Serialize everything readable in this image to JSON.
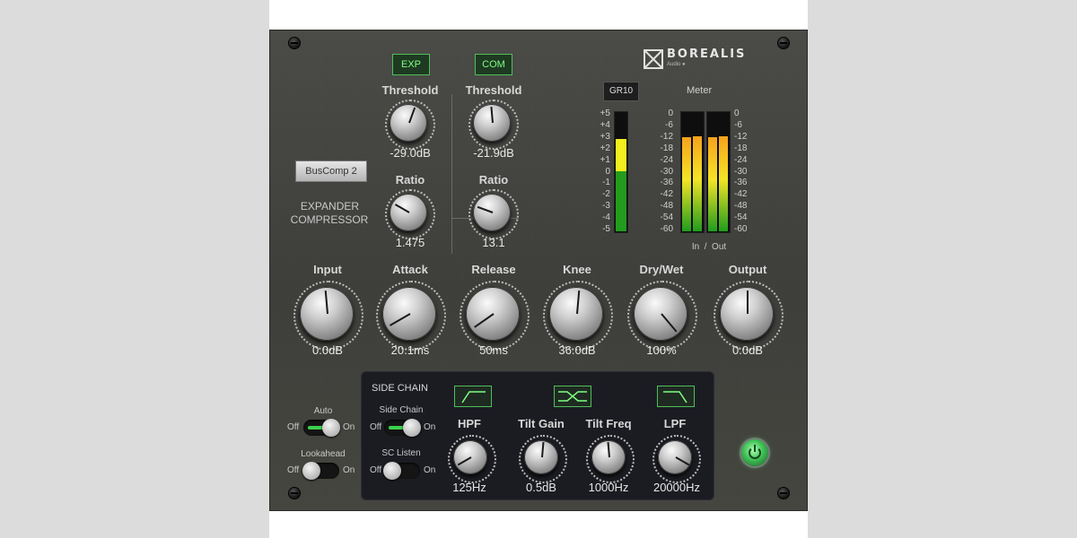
{
  "brand": {
    "name": "BOREALIS",
    "sub": "Audio ●"
  },
  "modes": {
    "exp": "EXP",
    "com": "COM"
  },
  "preset": {
    "label": "BusComp 2"
  },
  "mode_labels": {
    "expander": "EXPANDER",
    "compressor": "COMPRESSOR"
  },
  "expander": {
    "threshold_label": "Threshold",
    "threshold_value": "-29.0dB",
    "ratio_label": "Ratio",
    "ratio_value": "1.475"
  },
  "compressor": {
    "threshold_label": "Threshold",
    "threshold_value": "-21.9dB",
    "ratio_label": "Ratio",
    "ratio_value": "13.1"
  },
  "gr_meter": {
    "button": "GR10",
    "scale": [
      "+5",
      "+4",
      "+3",
      "+2",
      "+1",
      "0",
      "-1",
      "-2",
      "-3",
      "-4",
      "-5"
    ],
    "green_level": 0.5,
    "yellow_level": 0.42
  },
  "meter": {
    "title": "Meter",
    "scale": [
      "0",
      "-6",
      "-12",
      "-18",
      "-24",
      "-30",
      "-36",
      "-42",
      "-48",
      "-54",
      "-60"
    ],
    "in_out": "In  /  Out",
    "in_level": 0.78,
    "out_level": 0.78
  },
  "main_controls": {
    "input": {
      "label": "Input",
      "value": "0.0dB"
    },
    "attack": {
      "label": "Attack",
      "value": "20.1ms"
    },
    "release": {
      "label": "Release",
      "value": "50ms"
    },
    "knee": {
      "label": "Knee",
      "value": "36.0dB"
    },
    "drywet": {
      "label": "Dry/Wet",
      "value": "100%"
    },
    "output": {
      "label": "Output",
      "value": "0.0dB"
    }
  },
  "auto": {
    "label": "Auto",
    "off": "Off",
    "on": "On",
    "state": "on"
  },
  "lookahead": {
    "label": "Lookahead",
    "off": "Off",
    "on": "On",
    "state": "off"
  },
  "side_chain": {
    "title": "SIDE CHAIN",
    "sc_toggle": {
      "label": "Side Chain",
      "off": "Off",
      "on": "On",
      "state": "on"
    },
    "sc_listen": {
      "label": "SC Listen",
      "off": "Off",
      "on": "On",
      "state": "off"
    },
    "hpf": {
      "label": "HPF",
      "value": "125Hz"
    },
    "tilt_gain": {
      "label": "Tilt Gain",
      "value": "0.5dB"
    },
    "tilt_freq": {
      "label": "Tilt Freq",
      "value": "1000Hz"
    },
    "lpf": {
      "label": "LPF",
      "value": "20000Hz"
    }
  },
  "colors": {
    "panel": "#434340",
    "accent_green": "#3bd14a",
    "side_chain_bg": "#1b1c22"
  }
}
